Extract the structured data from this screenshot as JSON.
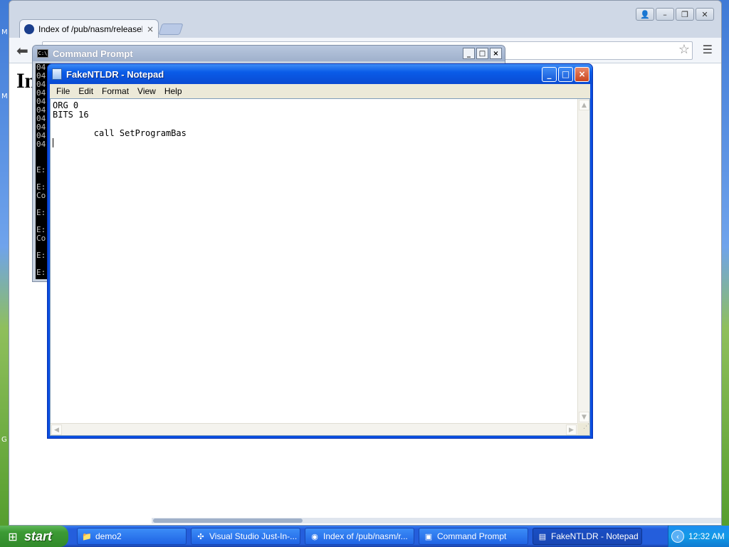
{
  "desktop": {
    "left_labels": [
      "M",
      "M",
      "G"
    ]
  },
  "chrome": {
    "tab_title": "Index of /pub/nasm/releasebuilds/",
    "tab_close": "×",
    "back_icon": "arrow-left-icon",
    "star_icon": "star-icon",
    "menu_icon": "hamburger-menu-icon",
    "page_heading": "In"
  },
  "cmd": {
    "title": "Command Prompt",
    "icon_text": "C:\\",
    "buttons": {
      "minimize": "_",
      "maximize": "□",
      "close": "×"
    },
    "lines": [
      "04",
      "04",
      "04",
      "04",
      "04",
      "04",
      "04",
      "04",
      "04",
      "04",
      "",
      "",
      "E:",
      "",
      "E:",
      "Co",
      "",
      "E:",
      "",
      "E:",
      "Co",
      "",
      "E:",
      "",
      "E:"
    ]
  },
  "notepad": {
    "title": "FakeNTLDR - Notepad",
    "menu": [
      "File",
      "Edit",
      "Format",
      "View",
      "Help"
    ],
    "buttons": {
      "minimize": "_",
      "maximize": "□",
      "close": "×"
    },
    "content": "ORG 0\nBITS 16\n\n        call SetProgramBas\n"
  },
  "taskbar": {
    "start_label": "start",
    "tasks": [
      {
        "label": "demo2",
        "icon": "folder-icon"
      },
      {
        "label": "Visual Studio Just-In-...",
        "icon": "visual-studio-icon"
      },
      {
        "label": "Index of /pub/nasm/r...",
        "icon": "chrome-icon"
      },
      {
        "label": "Command Prompt",
        "icon": "command-prompt-icon"
      },
      {
        "label": "FakeNTLDR - Notepad",
        "icon": "notepad-icon"
      }
    ],
    "clock": "12:32 AM"
  }
}
